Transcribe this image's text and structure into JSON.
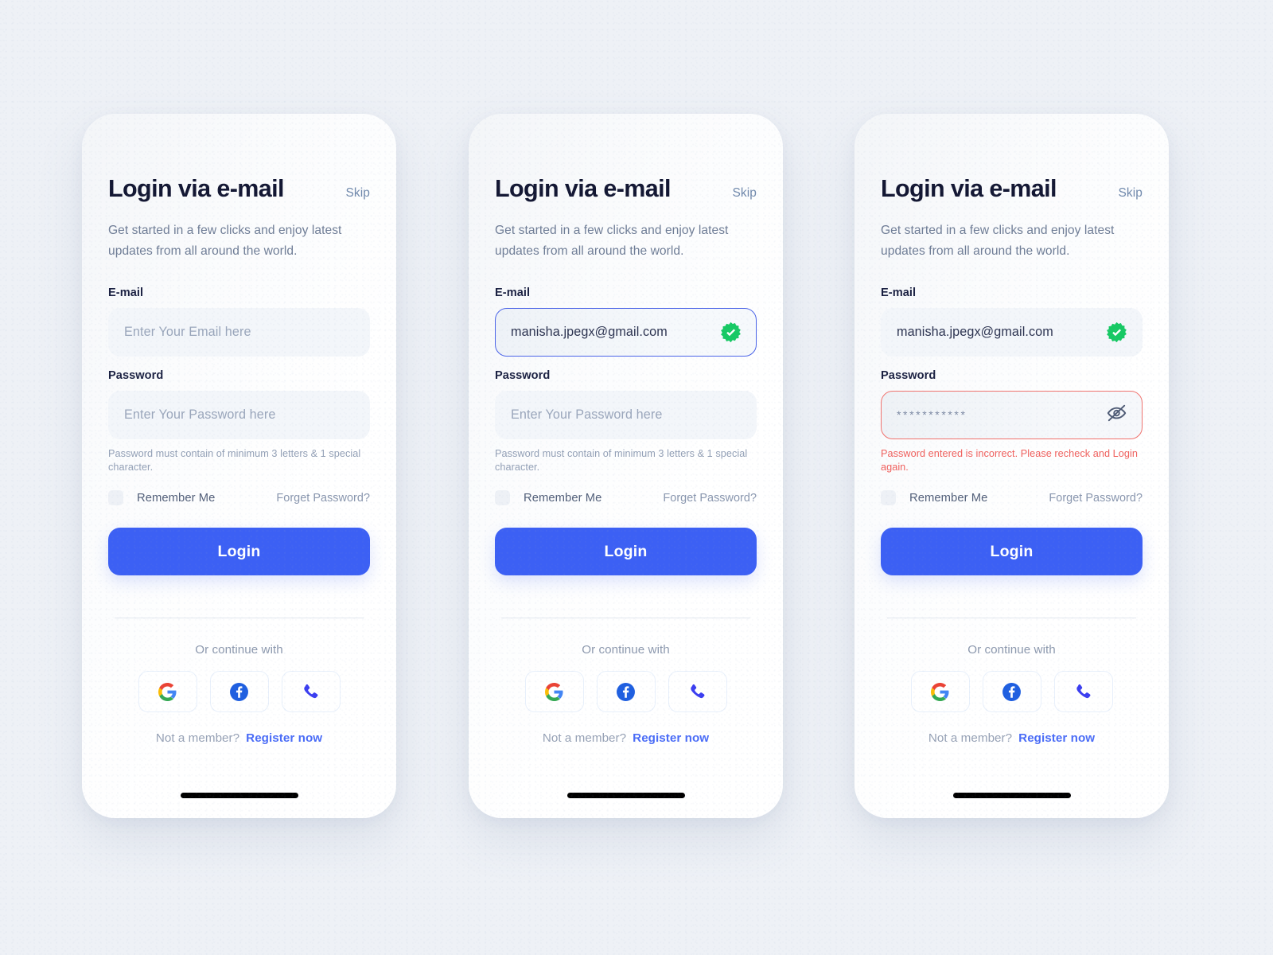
{
  "page": {
    "background_color": "#eef1f6",
    "accent_color": "#3c60f4",
    "error_color": "#f0605d",
    "success_color": "#17c964"
  },
  "shared": {
    "title": "Login via e-mail",
    "skip_label": "Skip",
    "subtitle": "Get started in a few clicks and enjoy latest updates from all around the world.",
    "email_label": "E-mail",
    "email_placeholder": "Enter Your Email here",
    "password_label": "Password",
    "password_placeholder": "Enter Your Password here",
    "password_helper": "Password must contain of minimum 3 letters & 1 special character.",
    "remember_label": "Remember Me",
    "forgot_label": "Forget Password?",
    "login_label": "Login",
    "continue_label": "Or continue with",
    "member_text": "Not a member?",
    "register_label": "Register now",
    "social": [
      {
        "name": "google",
        "label": "Google"
      },
      {
        "name": "facebook",
        "label": "Facebook"
      },
      {
        "name": "phone",
        "label": "Phone"
      }
    ]
  },
  "screens": [
    {
      "id": "empty-state",
      "email_value": "",
      "email_state": "placeholder",
      "password_value": "",
      "password_state": "placeholder",
      "helper_text": "Password must contain of minimum 3 letters & 1 special character.",
      "helper_state": "normal",
      "email_verified": false,
      "password_toggle": false
    },
    {
      "id": "email-verified-state",
      "email_value": "manisha.jpegx@gmail.com",
      "email_state": "focused",
      "password_value": "",
      "password_state": "placeholder",
      "helper_text": "Password must contain of minimum 3 letters & 1 special character.",
      "helper_state": "normal",
      "email_verified": true,
      "password_toggle": false
    },
    {
      "id": "password-error-state",
      "email_value": "manisha.jpegx@gmail.com",
      "email_state": "filled",
      "password_value": "***********",
      "password_state": "masked",
      "helper_text": "Password entered is incorrect. Please recheck and Login again.",
      "helper_state": "error",
      "email_verified": true,
      "password_toggle": true
    }
  ]
}
